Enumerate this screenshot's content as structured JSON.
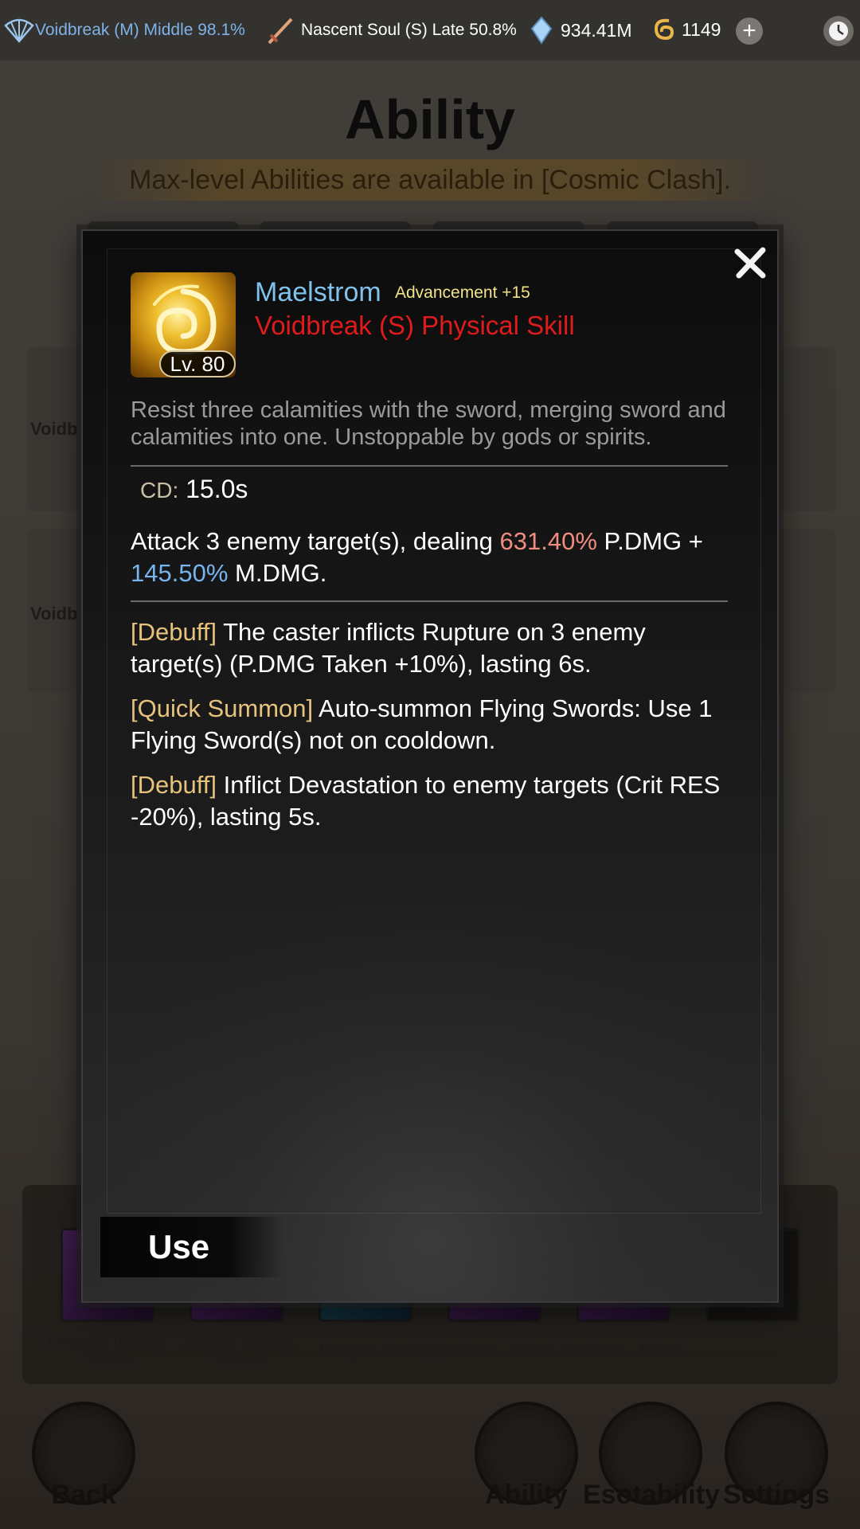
{
  "topbar": {
    "realm_main": "Voidbreak (M) Middle 98.1%",
    "realm_secondary": "Nascent Soul (S) Late 50.8%",
    "crystal_amount": "934.41M",
    "coin_amount": "1149",
    "plus_label": "+",
    "icons": [
      "fan-icon",
      "sword-icon",
      "crystal-icon",
      "coin-icon",
      "plus-icon",
      "clock-icon"
    ]
  },
  "page": {
    "title": "Ability",
    "notice": "Max-level Abilities are available in [Cosmic Clash].",
    "side_labels": [
      "Voidb",
      "Voidb"
    ],
    "slots": [
      "Dragon Taming - Water",
      "Dragon Taming - Wood",
      "Dragon Taming",
      "Tonitrus - Wood",
      "Tonitrus - Metal"
    ],
    "nav": {
      "back": "Back",
      "ability": "Ability",
      "esotability": "Esotability",
      "settings": "Settings"
    }
  },
  "modal": {
    "level": "Lv. 80",
    "name": "Maelstrom",
    "advancement": "Advancement +15",
    "type": "Voidbreak (S) Physical Skill",
    "description": "Resist three calamities with the sword, merging sword and calamities into one. Unstoppable by gods or spirits.",
    "cd_label": "CD:",
    "cd_value": "15.0s",
    "attack": {
      "prefix": "Attack 3 enemy target(s), dealing ",
      "pdmg_value": "631.40%",
      "pdmg_suffix": " P.DMG + ",
      "mdmg_value": "145.50%",
      "mdmg_suffix": " M.DMG."
    },
    "effects": [
      {
        "tag": "[Debuff]",
        "text": " The caster inflicts Rupture on 3 enemy target(s) (P.DMG Taken +10%), lasting 6s."
      },
      {
        "tag": "[Quick Summon]",
        "text": " Auto-summon Flying Swords: Use 1 Flying Sword(s) not on cooldown."
      },
      {
        "tag": "[Debuff]",
        "text": " Inflict Devastation to enemy targets (Crit RES -20%), lasting 5s."
      }
    ],
    "use_label": "Use",
    "colors": {
      "name": "#7fc2ec",
      "type": "#e01b1b",
      "pdmg": "#f08d7f",
      "mdmg": "#77b5ee",
      "tag": "#e6c27c",
      "advancement": "#f2e28a"
    }
  }
}
